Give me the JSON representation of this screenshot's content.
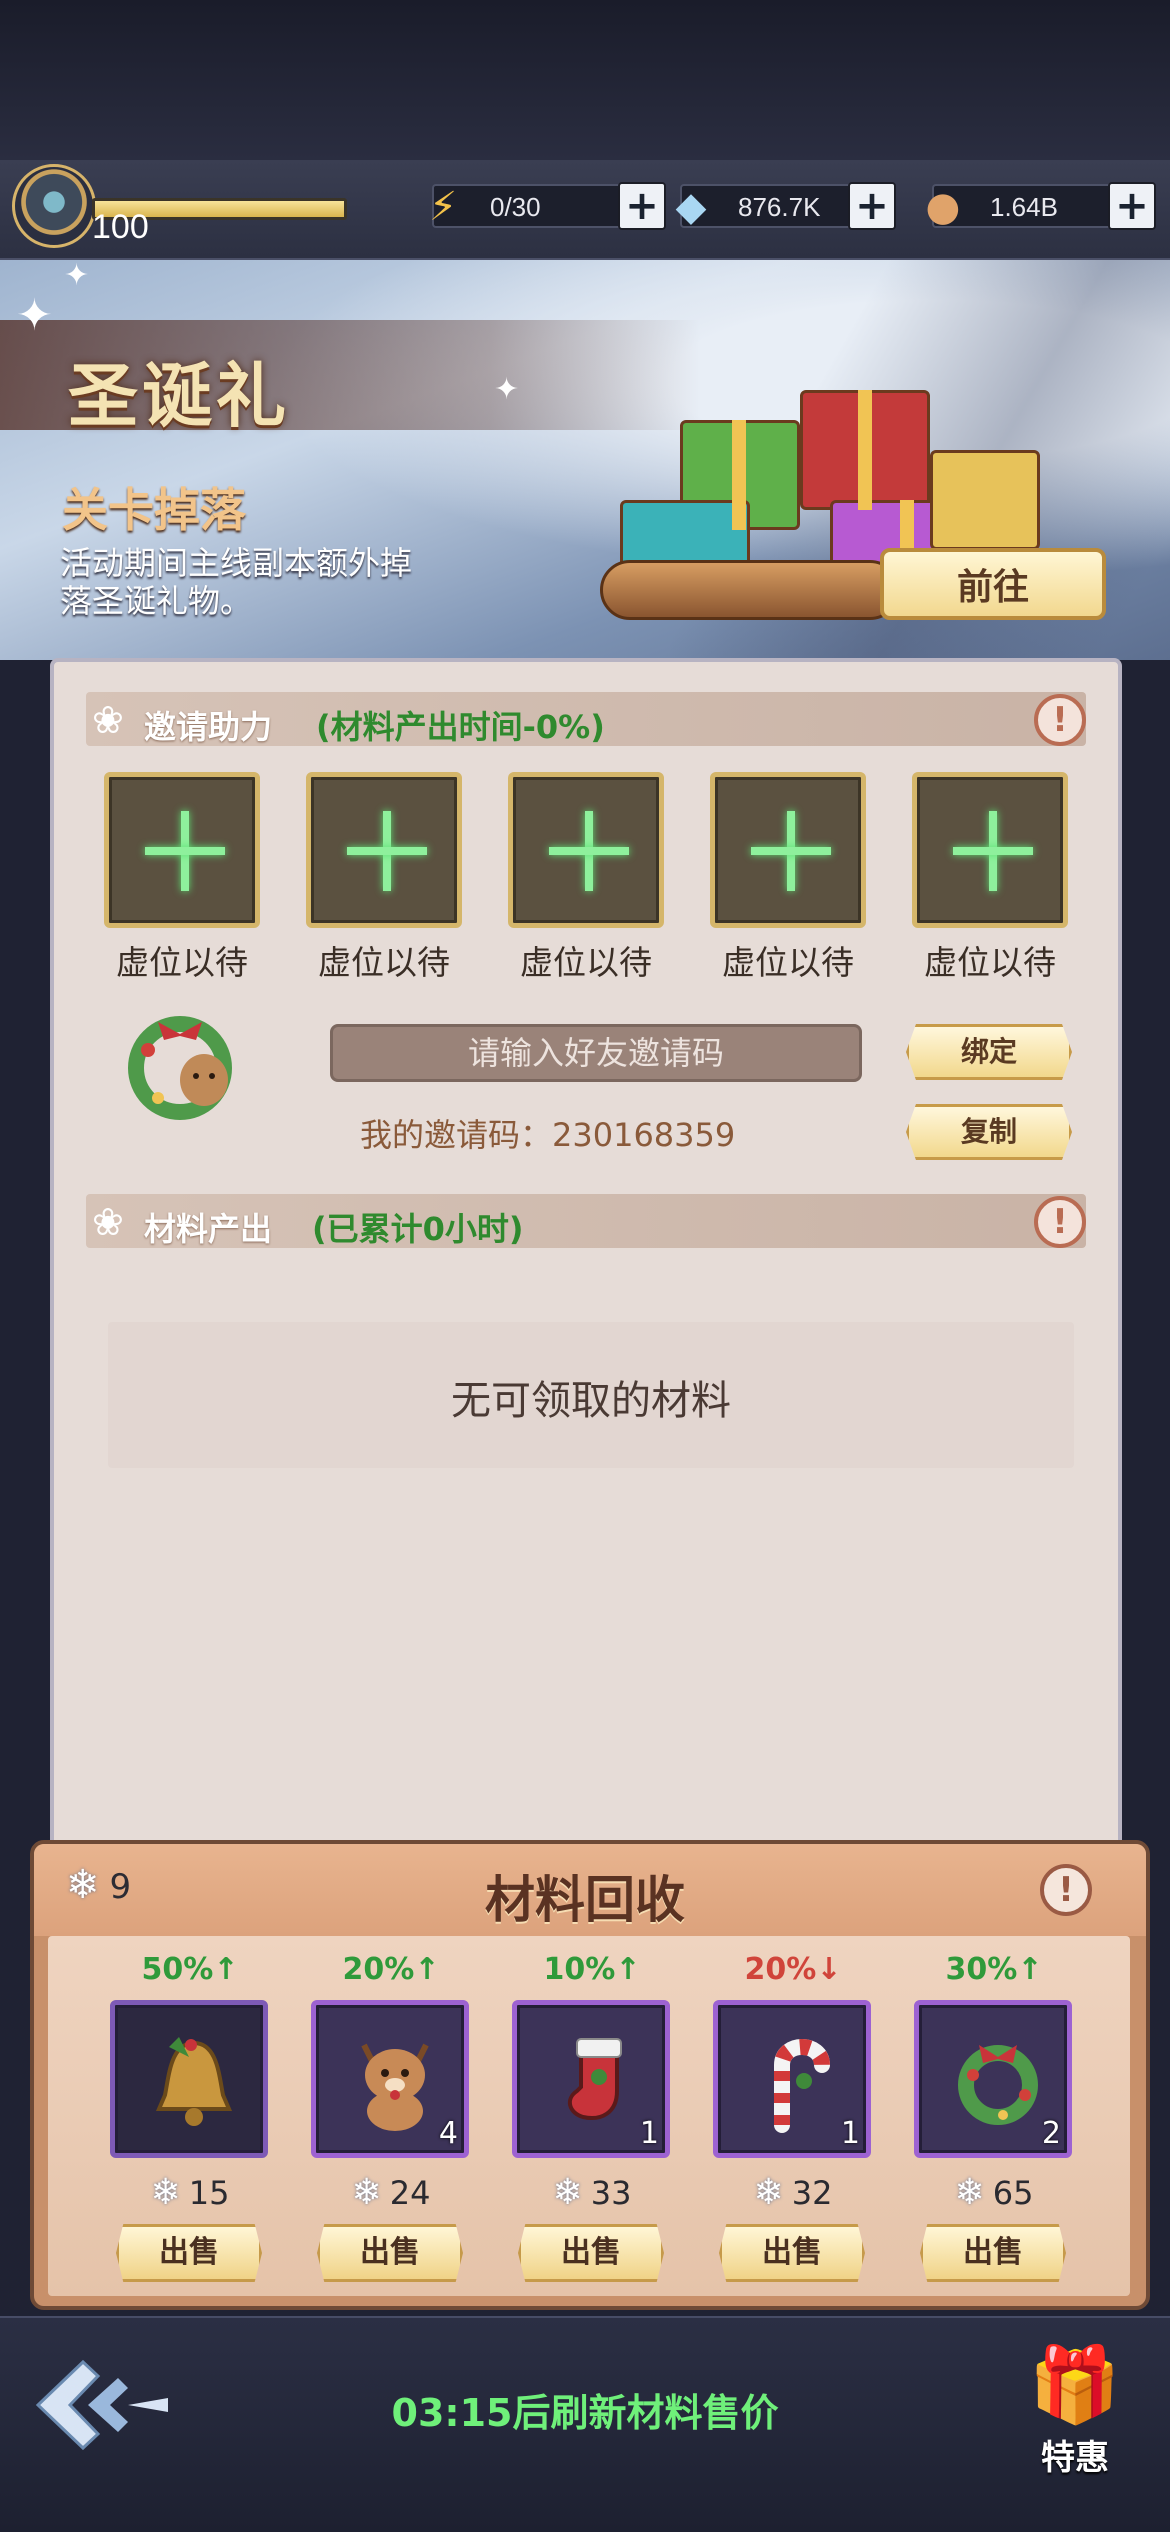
{
  "header": {
    "level": "100",
    "resources": [
      {
        "icon": "lightning-icon",
        "value": "0/30"
      },
      {
        "icon": "diamond-icon",
        "value": "876.7K"
      },
      {
        "icon": "coin-icon",
        "value": "1.64B"
      }
    ]
  },
  "banner": {
    "title": "圣诞礼",
    "subtitle": "关卡掉落",
    "description": "活动期间主线副本额外掉落圣诞礼物。",
    "goto_label": "前往"
  },
  "invite": {
    "title": "邀请助力",
    "note": "(材料产出时间-0%)",
    "slot_label": "虚位以待",
    "slots": 5,
    "input_placeholder": "请输入好友邀请码",
    "bind_label": "绑定",
    "copy_label": "复制",
    "my_code_text": "我的邀请码：230168359"
  },
  "output": {
    "title": "材料产出",
    "note": "(已累计0小时)",
    "empty_text": "无可领取的材料"
  },
  "recycle": {
    "title": "材料回收",
    "snowflakes": "9",
    "sell_label": "出售",
    "items": [
      {
        "name": "bell",
        "icon": "bell-icon",
        "change": "50%↑",
        "direction": "up",
        "qty": "",
        "price": "15"
      },
      {
        "name": "reindeer",
        "icon": "reindeer-icon",
        "change": "20%↑",
        "direction": "up",
        "qty": "4",
        "price": "24"
      },
      {
        "name": "stocking",
        "icon": "stocking-icon",
        "change": "10%↑",
        "direction": "up",
        "qty": "1",
        "price": "33"
      },
      {
        "name": "candy-cane",
        "icon": "candy-cane-icon",
        "change": "20%↓",
        "direction": "down",
        "qty": "1",
        "price": "32"
      },
      {
        "name": "wreath",
        "icon": "wreath-icon",
        "change": "30%↑",
        "direction": "up",
        "qty": "2",
        "price": "65"
      }
    ]
  },
  "footer": {
    "refresh_text": "03:15后刷新材料售价",
    "special_label": "特惠"
  },
  "colors": {
    "accent_gold": "#f2d88f",
    "green_text": "#2f8a2e",
    "up_green": "#2f9a3a",
    "down_red": "#d0443a",
    "refresh_green": "#6ff07a"
  }
}
